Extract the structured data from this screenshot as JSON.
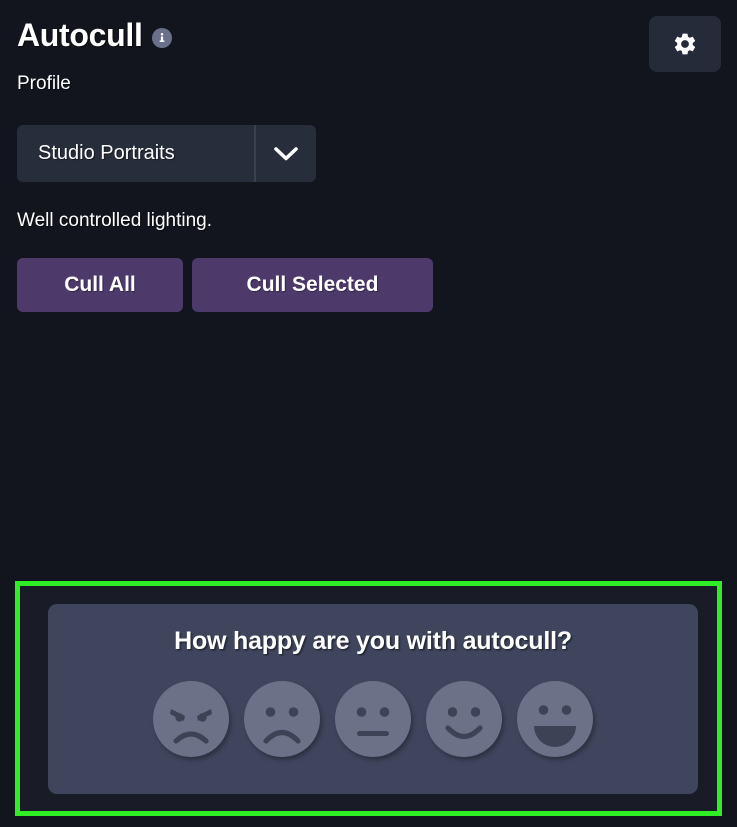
{
  "header": {
    "app_title": "Autocull",
    "info_icon": "info-icon",
    "profile_label": "Profile",
    "settings_icon": "gear-icon"
  },
  "profile_select": {
    "value": "Studio Portraits",
    "chevron_icon": "chevron-down-icon"
  },
  "description": "Well controlled lighting.",
  "actions": {
    "cull_all_label": "Cull All",
    "cull_selected_label": "Cull Selected"
  },
  "survey": {
    "question": "How happy are you with autocull?",
    "highlight_color": "#2fee26",
    "panel_color": "#3f455c",
    "face_color": "#6b7288",
    "ratings": [
      {
        "name": "angry-face-icon",
        "label": "Angry"
      },
      {
        "name": "sad-face-icon",
        "label": "Sad"
      },
      {
        "name": "neutral-face-icon",
        "label": "Neutral"
      },
      {
        "name": "smile-face-icon",
        "label": "Happy"
      },
      {
        "name": "grin-face-icon",
        "label": "Very Happy"
      }
    ]
  },
  "theme": {
    "background": "#12151e",
    "panel": "#282d3c",
    "accent_purple": "#4d3a6b",
    "text": "#ffffff"
  }
}
